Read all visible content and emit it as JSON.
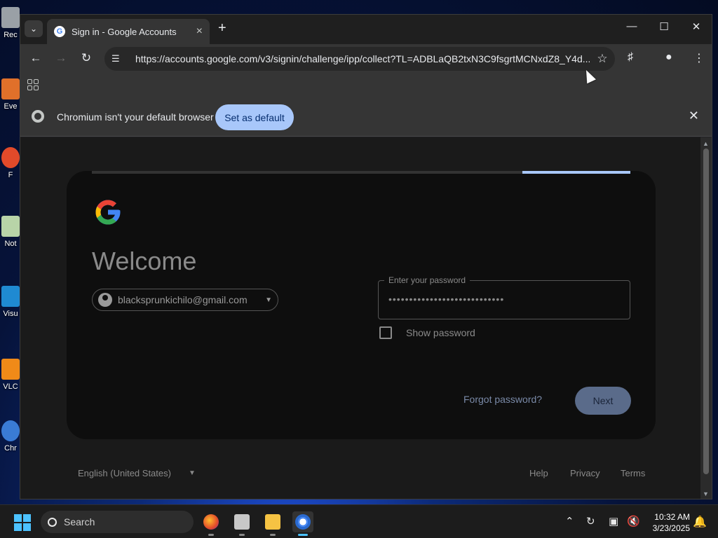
{
  "desktop": {
    "icons": [
      {
        "label": "Rec",
        "color": "#9aa0a6"
      },
      {
        "label": "Eve",
        "color": "#e0702a"
      },
      {
        "label": "F",
        "color": "#e24a2a"
      },
      {
        "label": "Not",
        "color": "#b8d4a8"
      },
      {
        "label": "Visu",
        "color": "#1f8ad2"
      },
      {
        "label": "VLC",
        "color": "#f08a18"
      },
      {
        "label": "Chr",
        "color": "#3a7bd5"
      }
    ]
  },
  "browser": {
    "tab": {
      "title": "Sign in - Google Accounts",
      "favicon": "google-g-icon"
    },
    "omnibox": {
      "url": "https://accounts.google.com/v3/signin/challenge/ipp/collect?TL=ADBLaQB2txN3C9fsgrtMCNxdZ8_Y4d..."
    },
    "infobar": {
      "message": "Chromium isn't your default browser",
      "button": "Set as default"
    }
  },
  "signin": {
    "progress_fraction": 0.2,
    "heading": "Welcome",
    "account_email": "blacksprunkichilo@gmail.com",
    "password_label": "Enter your password",
    "password_masked": "••••••••••••••••••••••••••••",
    "show_password_label": "Show password",
    "show_password_checked": false,
    "forgot_label": "Forgot password?",
    "next_label": "Next"
  },
  "footer": {
    "language": "English (United States)",
    "links": [
      "Help",
      "Privacy",
      "Terms"
    ]
  },
  "taskbar": {
    "search_label": "Search",
    "time": "10:32 AM",
    "date": "3/23/2025"
  },
  "colors": {
    "accent": "#a8c7fa",
    "next_button": "#5a6b8a",
    "taskbar_accent": "#4cc2ff"
  }
}
